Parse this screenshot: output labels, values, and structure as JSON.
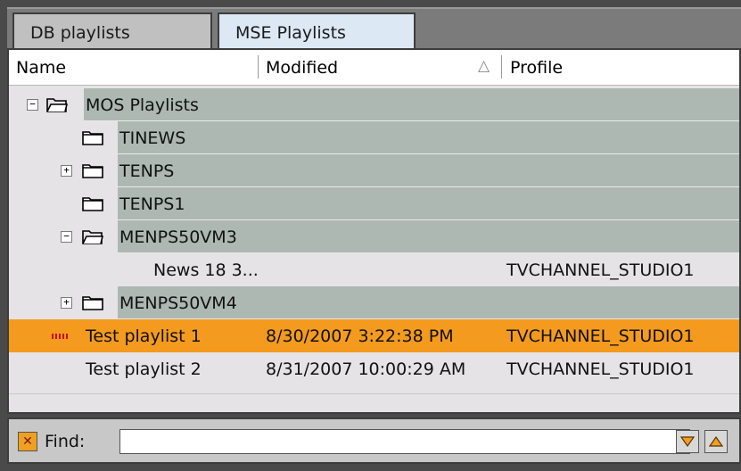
{
  "tabs": [
    {
      "label": "DB playlists",
      "active": false
    },
    {
      "label": "MSE Playlists",
      "active": true
    }
  ],
  "columns": {
    "name": "Name",
    "modified": "Modified",
    "sort_indicator": "△",
    "profile": "Profile"
  },
  "rows": [
    {
      "name": "MOS Playlists",
      "type": "folder",
      "state": "open",
      "expander": "⊟",
      "modified": "",
      "profile": ""
    },
    {
      "name": "TINEWS",
      "type": "folder",
      "state": "closed",
      "expander": "",
      "modified": "",
      "profile": ""
    },
    {
      "name": "TENPS",
      "type": "folder",
      "state": "closed",
      "expander": "⊞",
      "modified": "",
      "profile": ""
    },
    {
      "name": "TENPS1",
      "type": "folder",
      "state": "closed",
      "expander": "",
      "modified": "",
      "profile": ""
    },
    {
      "name": "MENPS50VM3",
      "type": "folder",
      "state": "open",
      "expander": "⊟",
      "modified": "",
      "profile": ""
    },
    {
      "name": "News 18 3...",
      "type": "item",
      "modified": "",
      "profile": "TVCHANNEL_STUDIO1"
    },
    {
      "name": "MENPS50VM4",
      "type": "folder",
      "state": "closed",
      "expander": "⊞",
      "modified": "",
      "profile": ""
    },
    {
      "name": "Test playlist 1",
      "type": "item",
      "selected": true,
      "modified": "8/30/2007 3:22:38 PM",
      "profile": "TVCHANNEL_STUDIO1"
    },
    {
      "name": "Test playlist 2",
      "type": "item",
      "modified": "8/31/2007 10:00:29 AM",
      "profile": "TVCHANNEL_STUDIO1"
    }
  ],
  "find": {
    "label": "Find:",
    "value": "",
    "clear_icon": "clear-find-icon"
  },
  "colors": {
    "selected_row": "#f39a1f",
    "folder_row": "#adb8b3",
    "panel_bg": "#e6e3e6"
  }
}
